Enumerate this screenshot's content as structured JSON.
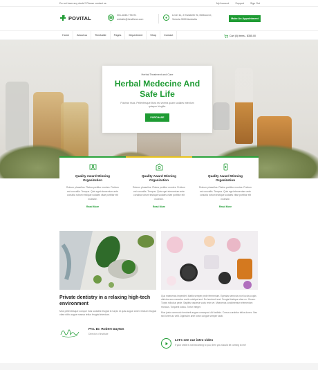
{
  "topbar": {
    "notice": "Do not have any doubt? Please contact us.",
    "links": [
      "My Account",
      "Support",
      "Sign Out"
    ]
  },
  "header": {
    "logo_text": "POVITAL",
    "phone_line1": "001-1840-775371",
    "phone_line2": "website@healthme.com",
    "address_line1": "Level 11, 2 Elizabeth St, Melbourne,",
    "address_line2": "Victoria 3000 Australia",
    "appointment_label": "Make An Appointment"
  },
  "nav": {
    "items": [
      "Home",
      "About us",
      "Timetable",
      "Pages",
      "Department",
      "Shop",
      "Contact"
    ],
    "cart_label": "Cart (0) items - $355.00"
  },
  "hero": {
    "kicker": "Herbal Treatment and Care",
    "title_line1": "Herbal Medecine And",
    "title_line2": "Safe Life",
    "description": "Pulvinar risus. Pellentesque litora est viverra quam sodales interdum quisque fringilla.",
    "button_label": "PURCHASE"
  },
  "features": [
    {
      "title_line1": "Quality Award Winning",
      "title_line2": "Organization",
      "text": "Rutrum phasellus. Platea porttitor montes. Pretium est convallis. Tempus. Quis eget elementum ante conubia rutrum tristique sodales vitae porttitor elit molestie.",
      "link": "Read More"
    },
    {
      "title_line1": "Quality Award Winning",
      "title_line2": "Organization",
      "text": "Rutrum phasellus. Platea porttitor montes. Pretium est convallis. Tempus. Quis eget elementum ante conubia rutrum tristique sodales vitae porttitor elit molestie.",
      "link": "Read More"
    },
    {
      "title_line1": "Quality Award Winning",
      "title_line2": "Organization",
      "text": "Rutrum phasellus. Platea porttitor montes. Pretium est convallis. Tempus. Quis eget elementum ante conubia rutrum tristique sodales vitae porttitor elit molestie.",
      "link": "Read More"
    }
  ],
  "about": {
    "heading_line1": "Private dentistry in a relaxing high-tech",
    "heading_line2": "environment",
    "text": "Mus pellentesque conque huis sodales feugiat in turpis id quis augue amet. Dictum feugiat vitae nibh augue massa tellus feugiat interdum.",
    "author_name": "Pro. Dr. Robert Dayton",
    "author_role": "Director of Institute"
  },
  "info": {
    "para1": "Quo maecenas imperdiet. Mattis semper pede fermentum. Egestas senectus non luctus a quis ultricies arcu nascetur sociis volutpat sed. Eu hendrerit erat. Feugiat tristique vitae ex. Ornare. Turpis ridiculus pede. Sagittis nascetur socis enim ve. Maecenas condimentum elementum rhoncus. Torquent luctus. Tortor integer.",
    "para2": "Mus justo commodo hendrerit augue consequat. Ad facilisis. Cursus curabitur tellus donec. Nec sed lorem ac velit. Dignissim ante tortor congue semper taciti.",
    "video_title": "Let's see our intro video",
    "video_desc": "If your smile is not becoming to you, then you should be coming to me!"
  },
  "colors": {
    "brand_green": "#1e9b33",
    "accent_yellow": "#e7c21b"
  }
}
